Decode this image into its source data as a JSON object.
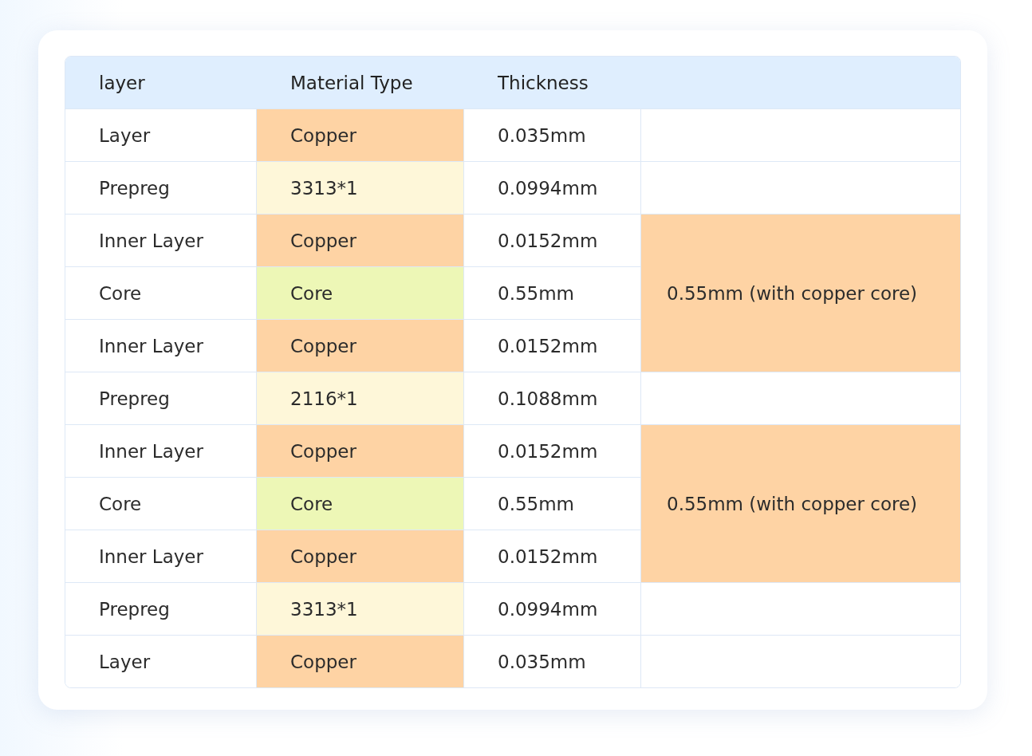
{
  "table": {
    "columns": [
      "layer",
      "Material Type",
      "Thickness"
    ],
    "row_groups": [
      {
        "rows": [
          {
            "layer": "Layer",
            "material": "Copper",
            "color": "#fed3a4",
            "thickness": "0.035mm"
          }
        ]
      },
      {
        "rows": [
          {
            "layer": "Prepreg",
            "material": "3313*1",
            "color": "#fef7d9",
            "thickness": "0.0994mm"
          }
        ]
      },
      {
        "note": "0.55mm (with copper core)",
        "color": "#fed3a4",
        "rows": [
          {
            "layer": "Inner Layer",
            "material": "Copper",
            "color": "#fed3a4",
            "thickness": "0.0152mm"
          },
          {
            "layer": "Core",
            "material": "Core",
            "color": "#edf7b6",
            "thickness": "0.55mm"
          },
          {
            "layer": "Inner Layer",
            "material": "Copper",
            "color": "#fed3a4",
            "thickness": "0.0152mm"
          }
        ]
      },
      {
        "rows": [
          {
            "layer": "Prepreg",
            "material": "2116*1",
            "color": "#fef7d9",
            "thickness": "0.1088mm"
          }
        ]
      },
      {
        "note": "0.55mm (with copper core)",
        "color": "#fed3a4",
        "rows": [
          {
            "layer": "Inner Layer",
            "material": "Copper",
            "color": "#fed3a4",
            "thickness": "0.0152mm"
          },
          {
            "layer": "Core",
            "material": "Core",
            "color": "#edf7b6",
            "thickness": "0.55mm"
          },
          {
            "layer": "Inner Layer",
            "material": "Copper",
            "color": "#fed3a4",
            "thickness": "0.0152mm"
          }
        ]
      },
      {
        "rows": [
          {
            "layer": "Prepreg",
            "material": "3313*1",
            "color": "#fef7d9",
            "thickness": "0.0994mm"
          }
        ]
      },
      {
        "rows": [
          {
            "layer": "Layer",
            "material": "Copper",
            "color": "#fed3a4",
            "thickness": "0.035mm"
          }
        ]
      }
    ]
  }
}
